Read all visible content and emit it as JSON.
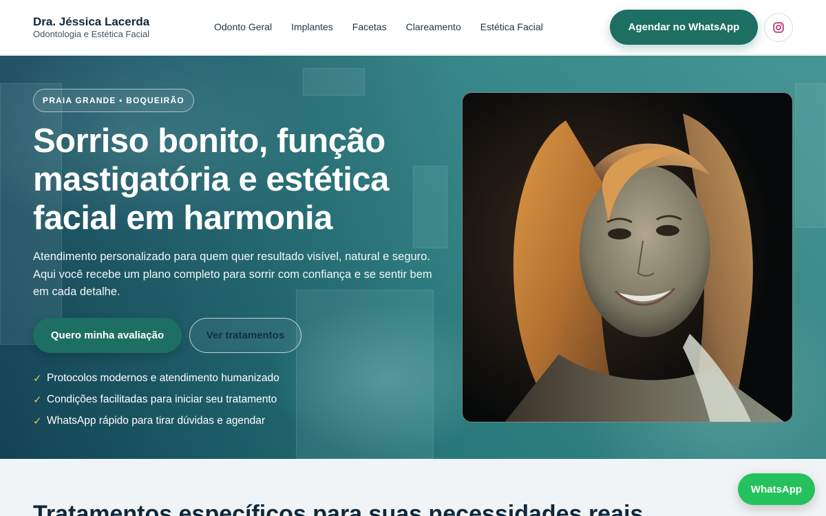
{
  "header": {
    "brand_name": "Dra. Jéssica Lacerda",
    "brand_subtitle": "Odontologia e Estética Facial",
    "nav": [
      "Odonto Geral",
      "Implantes",
      "Facetas",
      "Clareamento",
      "Estética Facial"
    ],
    "cta_label": "Agendar no WhatsApp",
    "instagram_icon": "instagram-icon"
  },
  "hero": {
    "badge": "PRAIA GRANDE • BOQUEIRÃO",
    "title": "Sorriso bonito, função mastigatória e estética facial em harmonia",
    "description": "Atendimento personalizado para quem quer resultado visível, natural e seguro. Aqui você recebe um plano completo para sorrir com confiança e se sentir bem em cada detalhe.",
    "primary_cta": "Quero minha avaliação",
    "secondary_cta": "Ver tratamentos",
    "bullets": [
      "Protocolos modernos e atendimento humanizado",
      "Condições facilitadas para iniciar seu tratamento",
      "WhatsApp rápido para tirar dúvidas e agendar"
    ],
    "check_icon": "✓"
  },
  "section": {
    "title": "Tratamentos específicos para suas necessidades reais"
  },
  "floating": {
    "whatsapp_label": "WhatsApp"
  },
  "colors": {
    "brand_green": "#1d6e63",
    "whatsapp_green": "#25c15c",
    "check_gold": "#f3c64a",
    "hero_teal": "#1f6870"
  }
}
